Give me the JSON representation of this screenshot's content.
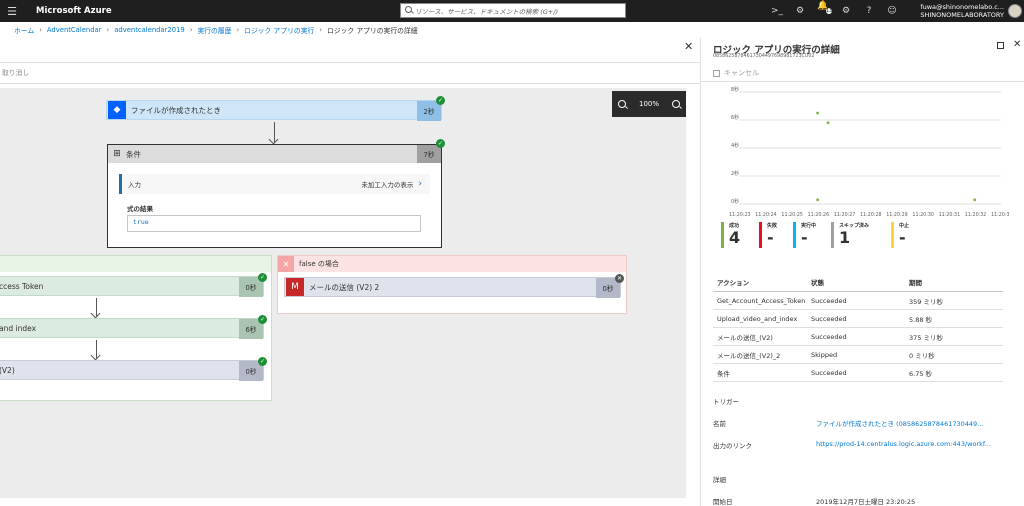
{
  "topbar": {
    "brand": "Microsoft Azure",
    "search_placeholder": "リソース、サービス、ドキュメントの検索 (G+/)",
    "notification_count": "13",
    "user_email": "fuwa@shinonomelabo.c...",
    "user_org": "SHINONOMELABORATORY"
  },
  "breadcrumb": [
    "ホーム",
    "AdventCalendar",
    "adventcalendar2019",
    "実行の履歴",
    "ロジック アプリの実行",
    "ロジック アプリの実行の詳細"
  ],
  "left": {
    "cmd_cancel": "取り消し",
    "zoom_level": "100%",
    "trigger_step": {
      "label": "ファイルが作成されたとき",
      "duration": "2秒"
    },
    "condition_step": {
      "label": "条件",
      "duration": "7秒",
      "input_label": "入力",
      "show_raw": "未加工入力の表示",
      "result_label": "式の結果",
      "result_value": "true"
    },
    "true_steps": [
      {
        "label": "ccess Token",
        "duration": "0秒"
      },
      {
        "label": "and index",
        "duration": "6秒"
      },
      {
        "label": "(V2)",
        "duration": "0秒"
      }
    ],
    "false_branch": {
      "title": "false の場合",
      "step_label": "メールの送信 (V2) 2",
      "step_duration": "0秒"
    }
  },
  "right": {
    "title": "ロジック アプリの実行の詳細",
    "run_id": "08586258784617304497698981723CU02",
    "cancel_label": "キャンセル",
    "chart_data": {
      "type": "scatter",
      "yticks": [
        "8秒",
        "6秒",
        "4秒",
        "2秒",
        "0秒"
      ],
      "xticks": [
        "11:20:23",
        "11:20:24",
        "11:20:25",
        "11:20:26",
        "11:20:27",
        "11:20:28",
        "11:20:29",
        "11:20:30",
        "11:20:31",
        "11:20:32",
        "11:20:33"
      ],
      "points": [
        {
          "x": "11:20:26",
          "y": 6.5,
          "color": "#7cb342"
        },
        {
          "x": "11:20:26.4",
          "y": 5.8,
          "color": "#7cb342"
        },
        {
          "x": "11:20:26",
          "y": 0.3,
          "color": "#7cb342"
        },
        {
          "x": "11:20:32",
          "y": 0.3,
          "color": "#7cb342"
        }
      ]
    },
    "stats": [
      {
        "label": "成功",
        "value": "4",
        "color": "#7cb342"
      },
      {
        "label": "失敗",
        "value": "-",
        "color": "#e81123"
      },
      {
        "label": "実行中",
        "value": "-",
        "color": "#00b7ef"
      },
      {
        "label": "スキップ済み",
        "value": "1",
        "color": "#a0a0a0"
      },
      {
        "label": "中止",
        "value": "-",
        "color": "#ffd335"
      }
    ],
    "table": {
      "headers": [
        "アクション",
        "状態",
        "期間"
      ],
      "rows": [
        [
          "Get_Account_Access_Token",
          "Succeeded",
          "359 ミリ秒"
        ],
        [
          "Upload_video_and_index",
          "Succeeded",
          "5.88 秒"
        ],
        [
          "メールの送信_(V2)",
          "Succeeded",
          "375 ミリ秒"
        ],
        [
          "メールの送信_(V2)_2",
          "Skipped",
          "0 ミリ秒"
        ],
        [
          "条件",
          "Succeeded",
          "6.75 秒"
        ]
      ]
    },
    "trigger_section": "トリガー",
    "name_label": "名前",
    "name_value": "ファイルが作成されたとき (0858625878461730449...",
    "output_link_label": "出力のリンク",
    "output_link_value": "https://prod-14.centralus.logic.azure.com:443/workf...",
    "details_section": "詳細",
    "start_label": "開始日",
    "start_value": "2019年12月7日土曜日 23:20:25"
  }
}
